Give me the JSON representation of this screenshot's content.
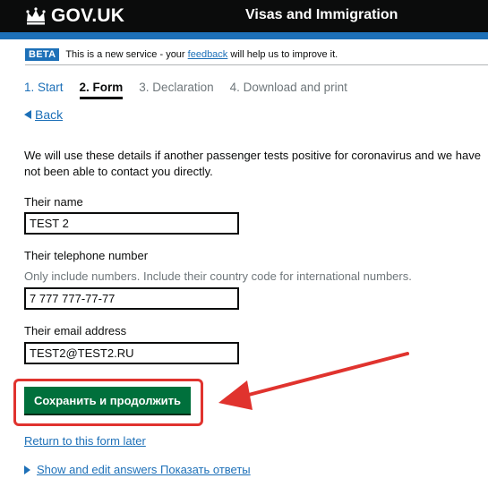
{
  "header": {
    "brand": "GOV.UK",
    "service": "Visas and Immigration"
  },
  "phase": {
    "tag": "BETA",
    "text_before": "This is a new service - your",
    "link": "feedback",
    "text_after": "will help us to improve it."
  },
  "steps": [
    "1. Start",
    "2. Form",
    "3. Declaration",
    "4. Download and print"
  ],
  "back": {
    "label": "Back"
  },
  "form": {
    "intro": "We will use these details if another passenger tests positive for coronavirus and we have not been able to contact you directly.",
    "name_label": "Their name",
    "name_value": "TEST 2",
    "phone_label": "Their telephone number",
    "phone_hint": "Only include numbers. Include their country code for international numbers.",
    "phone_value": "7 777 777-77-77",
    "email_label": "Their email address",
    "email_value": "TEST2@TEST2.RU",
    "submit_label": "Сохранить и продолжить",
    "return_link": "Return to this form later",
    "details_label": "Show and edit answers Показать ответы"
  },
  "colors": {
    "header_bg": "#0b0c0c",
    "accent_blue": "#1d70b8",
    "button_green": "#00703c",
    "highlight_red": "#e0332e"
  }
}
